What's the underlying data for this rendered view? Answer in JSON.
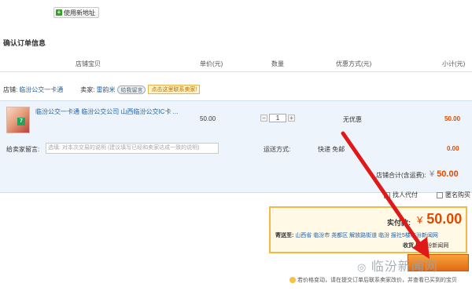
{
  "toolbar": {
    "new_address_label": "使用新地址"
  },
  "section_title": "确认订单信息",
  "table_headers": {
    "item": "店铺宝贝",
    "unit_price": "单价(元)",
    "quantity": "数量",
    "discount": "优惠方式(元)",
    "subtotal": "小计(元)"
  },
  "shop": {
    "label": "店铺:",
    "name": "临汾公交一卡通",
    "seller_label": "卖家:",
    "seller_name": "雷韵米",
    "wang_label": "给我留言",
    "contact_tip": "点击这里联系卖家!"
  },
  "item": {
    "title": "临汾公交一卡通 临汾公交公司 山西临汾公交IC卡 ...",
    "badge": "7",
    "unit_price": "50.00",
    "quantity": "1",
    "discount": "无优惠",
    "subtotal": "50.00"
  },
  "message": {
    "label": "给卖家留言:",
    "placeholder": "选填: 对本次交易的说明 (建议填写已经和卖家达成一致的说明)",
    "shipping_label": "运送方式:",
    "shipping_value": "快递 免邮",
    "shipping_cost": "0.00"
  },
  "shop_total": {
    "label": "店铺合计(含运费):",
    "currency": "¥",
    "value": "50.00"
  },
  "options": {
    "proxy_pay": "找人代付",
    "anonymous": "匿名购买"
  },
  "payment": {
    "label": "实付款:",
    "currency": "¥",
    "value": "50.00",
    "ship_to_label": "寄送至:",
    "ship_to_address": "山西省 临汾市 尧都区 解放路街道 临汾 报社5楼临汾新闻网",
    "receiver_label": "收货人:",
    "receiver_name": "临汾新闻网"
  },
  "watermark": "临汾新闻网",
  "footer_note": "若价格变动，请在提交订单后联系卖家改价，并查看已买到的宝贝",
  "colors": {
    "accent_orange": "#e04a00",
    "link_blue": "#1f5fa8",
    "arrow_red": "#e01818"
  }
}
